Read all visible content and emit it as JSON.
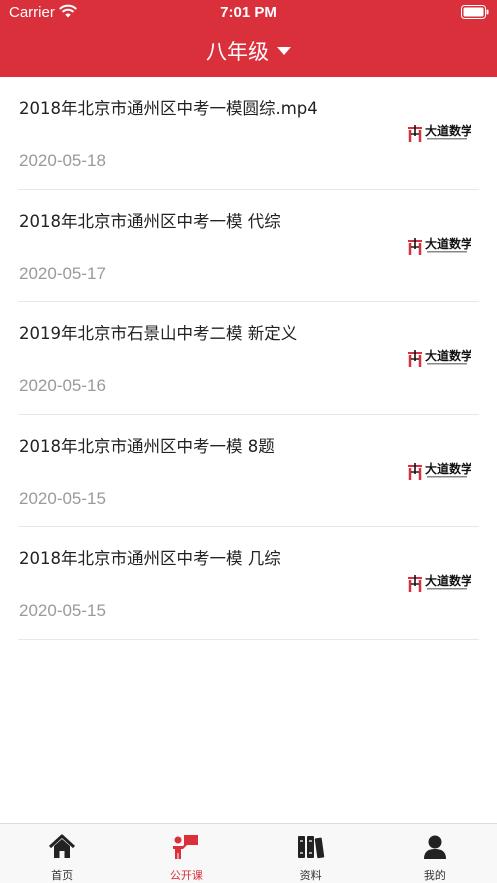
{
  "status_bar": {
    "carrier": "Carrier",
    "time": "7:01 PM"
  },
  "header": {
    "grade": "八年级"
  },
  "colors": {
    "brand": "#d9303c",
    "date_text": "#9a9a9a"
  },
  "list": {
    "items": [
      {
        "title": "2018年北京市通州区中考一模圆综.mp4",
        "date": "2020-05-18",
        "logo": "dadao-logo"
      },
      {
        "title": "2018年北京市通州区中考一模 代综",
        "date": "2020-05-17",
        "logo": "dadao-logo"
      },
      {
        "title": "2019年北京市石景山中考二模 新定义",
        "date": "2020-05-16",
        "logo": "dadao-logo"
      },
      {
        "title": "2018年北京市通州区中考一模 8题",
        "date": "2020-05-15",
        "logo": "dadao-logo"
      },
      {
        "title": "2018年北京市通州区中考一模 几综",
        "date": "2020-05-15",
        "logo": "dadao-logo"
      }
    ]
  },
  "tabbar": {
    "tabs": [
      {
        "label": "首页",
        "icon": "home-icon"
      },
      {
        "label": "公开课",
        "icon": "teacher-icon",
        "active": true
      },
      {
        "label": "资料",
        "icon": "books-icon"
      },
      {
        "label": "我的",
        "icon": "person-icon"
      }
    ]
  }
}
